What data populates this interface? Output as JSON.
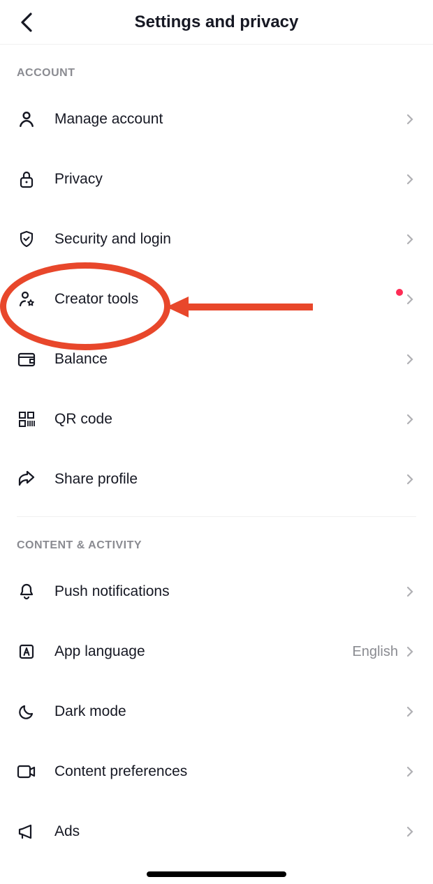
{
  "header": {
    "title": "Settings and privacy"
  },
  "sections": {
    "account": {
      "header": "ACCOUNT",
      "items": {
        "manage": "Manage account",
        "privacy": "Privacy",
        "security": "Security and login",
        "creator": "Creator tools",
        "balance": "Balance",
        "qr": "QR code",
        "share": "Share profile"
      }
    },
    "content": {
      "header": "CONTENT & ACTIVITY",
      "items": {
        "push": "Push notifications",
        "language": {
          "label": "App language",
          "value": "English"
        },
        "dark": "Dark mode",
        "pref": "Content preferences",
        "ads": "Ads"
      }
    }
  },
  "annotation": {
    "highlighted_item": "Creator tools",
    "color": "#e8472b"
  }
}
